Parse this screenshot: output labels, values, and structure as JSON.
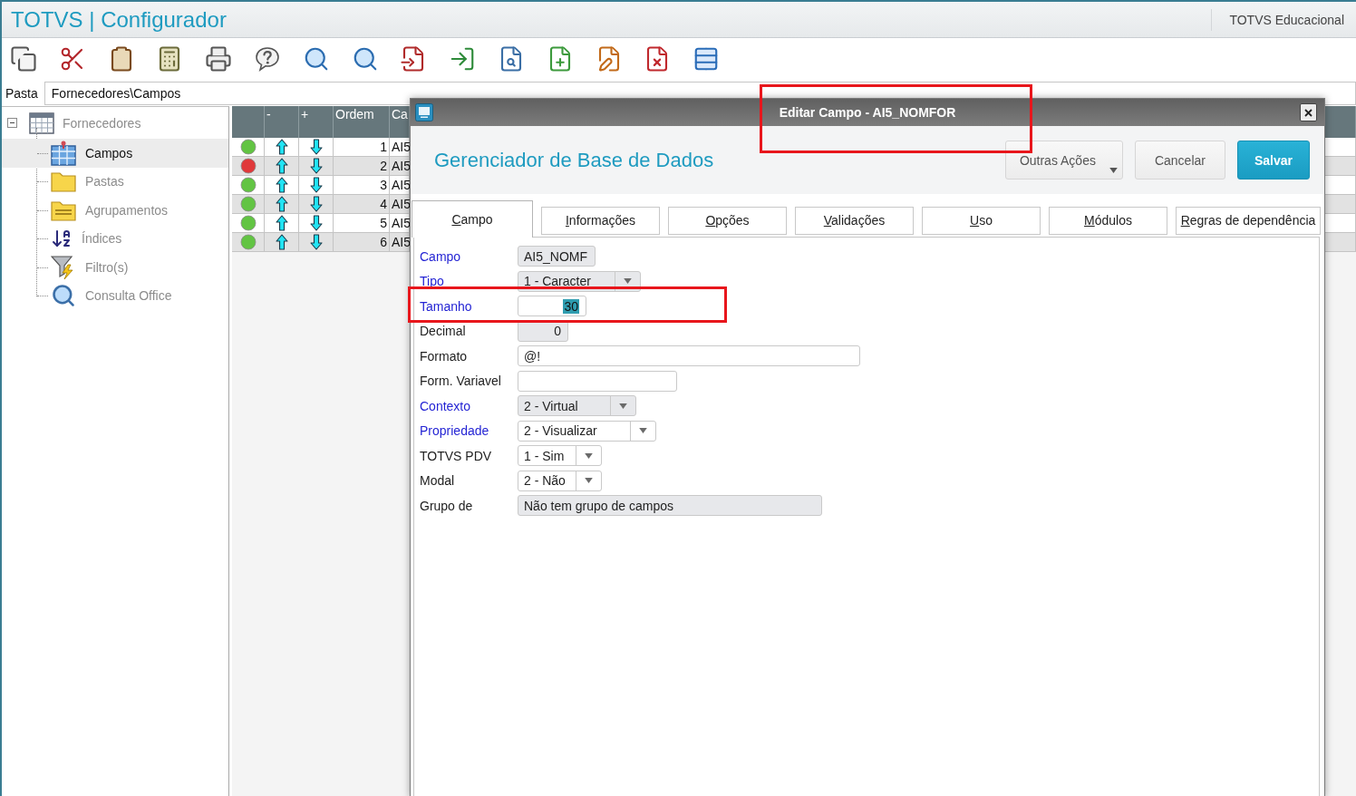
{
  "app": {
    "title": "TOTVS | Configurador",
    "environment": "TOTVS Educacional"
  },
  "path": {
    "label": "Pasta",
    "value": "Fornecedores\\Campos"
  },
  "tree": [
    {
      "label": "Fornecedores",
      "expanded": true,
      "selected": false,
      "children": [
        {
          "label": "Campos",
          "selected": true
        },
        {
          "label": "Pastas",
          "selected": false
        },
        {
          "label": "Agrupamentos",
          "selected": false
        },
        {
          "label": "Índices",
          "selected": false
        },
        {
          "label": "Filtro(s)",
          "selected": false
        },
        {
          "label": "Consulta Office",
          "selected": false
        }
      ]
    }
  ],
  "grid": {
    "columns": [
      "-",
      "+",
      "Ordem",
      "Ca"
    ],
    "rows": [
      {
        "color": "#62c443",
        "ordem": "1",
        "column_5": "AI5"
      },
      {
        "color": "#e0383a",
        "ordem": "2",
        "column_5": "AI5"
      },
      {
        "color": "#62c443",
        "ordem": "3",
        "column_5": "AI5"
      },
      {
        "color": "#62c443",
        "ordem": "4",
        "column_5": "AI5"
      },
      {
        "color": "#62c443",
        "ordem": "5",
        "column_5": "AI5"
      },
      {
        "color": "#62c443",
        "ordem": "6",
        "column_5": "AI5"
      }
    ]
  },
  "dialog": {
    "title": {
      "text": "Editar Campo - AI5_NOMFOR",
      "highlighted": true
    },
    "heading": "Gerenciador de Base de Dados",
    "buttons": [
      {
        "label": "Outras Ações",
        "kind": "menu"
      },
      {
        "label": "Cancelar",
        "kind": "default"
      },
      {
        "label": "Salvar",
        "kind": "primary"
      }
    ],
    "tabs": [
      {
        "label": "Campo",
        "selected": true
      },
      {
        "label": "Informações",
        "selected": false
      },
      {
        "label": "Opções",
        "selected": false
      },
      {
        "label": "Validações",
        "selected": false
      },
      {
        "label": "Uso",
        "selected": false
      },
      {
        "label": "Módulos",
        "selected": false
      },
      {
        "label": "Regras de dependência",
        "selected": false
      }
    ],
    "fields": [
      {
        "label": "Campo",
        "kind": "text",
        "value": "AI5_NOMF",
        "required": true,
        "disabled": true,
        "highlighted": false,
        "value_selected": false
      },
      {
        "label": "Tipo",
        "kind": "select",
        "value": "1 - Caracter",
        "required": true,
        "disabled": true,
        "highlighted": false,
        "value_selected": false
      },
      {
        "label": "Tamanho",
        "kind": "number",
        "value": "30",
        "required": true,
        "disabled": false,
        "highlighted": true,
        "value_selected": true
      },
      {
        "label": "Decimal",
        "kind": "number",
        "value": "0",
        "required": false,
        "disabled": true,
        "highlighted": false,
        "value_selected": false
      },
      {
        "label": "Formato",
        "kind": "text",
        "value": "@!",
        "required": false,
        "disabled": false,
        "highlighted": false,
        "value_selected": false
      },
      {
        "label": "Form. Variavel",
        "kind": "text",
        "required": false,
        "disabled": false,
        "highlighted": false
      },
      {
        "label": "Contexto",
        "kind": "select",
        "value": "2 - Virtual",
        "required": true,
        "disabled": true,
        "highlighted": false,
        "value_selected": false
      },
      {
        "label": "Propriedade",
        "kind": "select",
        "value": "2 - Visualizar",
        "required": true,
        "disabled": false,
        "highlighted": false,
        "value_selected": false
      },
      {
        "label": "TOTVS PDV",
        "kind": "select",
        "value": "1 - Sim",
        "required": false,
        "disabled": false,
        "highlighted": false,
        "value_selected": false
      },
      {
        "label": "Modal",
        "kind": "select",
        "value": "2 - Não",
        "required": false,
        "disabled": false,
        "highlighted": false,
        "value_selected": false
      },
      {
        "label": "Grupo de",
        "kind": "text",
        "value": "Não tem grupo de campos",
        "required": false,
        "disabled": true,
        "highlighted": false,
        "value_selected": false
      }
    ]
  }
}
